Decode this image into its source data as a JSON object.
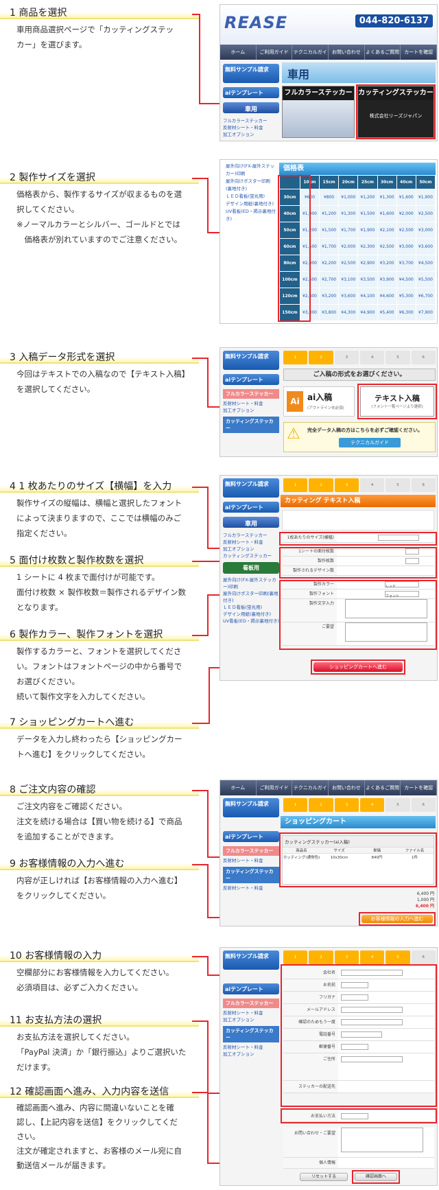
{
  "steps": [
    {
      "title": "1 商品を選択",
      "body": [
        "車用商品選択ページで「カッティングステッ",
        "カー」を選びます。"
      ]
    },
    {
      "title": "2 製作サイズを選択",
      "body": [
        "価格表から、製作するサイズが収まるものを選",
        "択してください。"
      ],
      "note": [
        "※ノーマルカラーとシルバー、ゴールドとでは",
        "　価格表が別れていますのでご注意ください。"
      ]
    },
    {
      "title": "3 入稿データ形式を選択",
      "body": [
        "今回はテキストでの入稿なので【テキスト入稿】",
        "を選択してください。"
      ]
    },
    {
      "title": "4 1 枚あたりのサイズ【横幅】を入力",
      "body": [
        "製作サイズの縦幅は、横幅と選択したフォント",
        "によって決まりますので、ここでは横幅のみご",
        "指定ください。"
      ]
    },
    {
      "title": "5 面付け枚数と製作枚数を選択",
      "body": [
        "1 シートに 4 枚まで面付けが可能です。",
        "面付け枚数 × 製作枚数＝製作されるデザイン数",
        "となります。"
      ]
    },
    {
      "title": "6 製作カラー、製作フォントを選択",
      "body": [
        "製作するカラーと、フォントを選択してくださ",
        "い。フォントはフォントページの中から番号で",
        "お選びください。",
        "続いて製作文字を入力してください。"
      ]
    },
    {
      "title": "7 ショッピングカートへ進む",
      "body": [
        "データを入力し終わったら【ショッピングカー",
        "トへ進む】をクリックしてください。"
      ]
    },
    {
      "title": "8 ご注文内容の確認",
      "body": [
        "ご注文内容をご確認ください。",
        "注文を続ける場合は【買い物を続ける】で商品",
        "を追加することができます。"
      ]
    },
    {
      "title": "9 お客様情報の入力へ進む",
      "body": [
        "内容が正しければ【お客様情報の入力へ進む】",
        "をクリックしてください。"
      ]
    },
    {
      "title": "10 お客様情報の入力",
      "body": [
        "空欄部分にお客様情報を入力してください。",
        "必須項目は、必ずご入力ください。"
      ]
    },
    {
      "title": "11 お支払方法の選択",
      "body": [
        "お支払方法を選択してください。",
        "「PayPal 決済」か「銀行振込」よりご選択いた",
        "だけます。"
      ]
    },
    {
      "title": "12 確認画面へ進み、入力内容を送信",
      "body": [
        "確認画面へ進み、内容に間違いないことを確",
        "認し、【上記内容を送信】をクリックしてくだ",
        "さい。",
        "注文が確定されますと、お客様のメール宛に自",
        "動送信メールが届きます。"
      ]
    }
  ],
  "shot1": {
    "logo": "REASE",
    "tel": "044-820-6137",
    "nav": [
      "ホーム",
      "ご利用ガイド",
      "テクニカルガイド",
      "お問い合わせ",
      "よくあるご質問",
      "カートを確認"
    ],
    "sample_btn": "無料サンプル請求",
    "ai_btn": "aiテンプレート",
    "car_btn": "車用",
    "banner": "車用",
    "card_full": "フルカラーステッカー",
    "card_cut": "カッティングステッカー",
    "card_cut_sub": "株式会社リーズジャパン",
    "links": [
      "フルカラーステッカー",
      "反射材シート・料金",
      "加工オプション"
    ]
  },
  "shot2": {
    "title": "価格表",
    "cols": [
      "10cm",
      "15cm",
      "20cm",
      "25cm",
      "30cm",
      "40cm",
      "50cm"
    ],
    "rows": [
      {
        "h": "30cm",
        "v": [
          "¥600",
          "¥800",
          "¥1,000",
          "¥1,200",
          "¥1,300",
          "¥1,600",
          "¥1,900"
        ]
      },
      {
        "h": "40cm",
        "v": [
          "¥1,000",
          "¥1,200",
          "¥1,300",
          "¥1,500",
          "¥1,600",
          "¥2,000",
          "¥2,500"
        ]
      },
      {
        "h": "50cm",
        "v": [
          "¥1,200",
          "¥1,500",
          "¥1,700",
          "¥1,900",
          "¥2,100",
          "¥2,500",
          "¥3,000"
        ]
      },
      {
        "h": "60cm",
        "v": [
          "¥1,500",
          "¥1,700",
          "¥2,000",
          "¥2,300",
          "¥2,500",
          "¥3,000",
          "¥3,600"
        ]
      },
      {
        "h": "80cm",
        "v": [
          "¥2,000",
          "¥2,200",
          "¥2,500",
          "¥2,900",
          "¥3,200",
          "¥3,700",
          "¥4,500"
        ]
      },
      {
        "h": "100cm",
        "v": [
          "¥2,500",
          "¥2,700",
          "¥3,100",
          "¥3,500",
          "¥3,900",
          "¥4,500",
          "¥5,500"
        ]
      },
      {
        "h": "120cm",
        "v": [
          "¥2,800",
          "¥3,200",
          "¥3,600",
          "¥4,100",
          "¥4,600",
          "¥5,300",
          "¥6,700"
        ]
      },
      {
        "h": "150cm",
        "v": [
          "¥3,300",
          "¥3,800",
          "¥4,300",
          "¥4,900",
          "¥5,400",
          "¥6,300",
          "¥7,900"
        ]
      }
    ],
    "links": [
      "屋外向け(FX-屋外ステッカー)印刷",
      "屋外向けポスター印刷(裏地付き)",
      "ＬＥＤ看板(蛍光用)",
      "デザイン用紙(裏地付き)",
      "UV看板(ED・掲示裏地付き)"
    ]
  },
  "shot3": {
    "heading": "ご入稿の形式をお選びください。",
    "ai_label": "ai入稿",
    "ai_sub": "(アウトライン化必須)",
    "text_label": "テキスト入稿",
    "text_sub": "(フォント一覧ページより選択)",
    "warn": "完全データ入稿の方はこちらを必ずご確認ください。",
    "guide": "テクニカルガイド",
    "full_sec": "フルカラーステッカー",
    "cut_sec": "カッティングステッカー"
  },
  "shot4": {
    "title": "カッティング テキスト入稿",
    "fields": [
      "1枚あたりのサイズ(横幅)",
      "1シートの面付枚数",
      "製作枚数",
      "製作されるデザイン数",
      "製作カラー",
      "製作フォント",
      "製作文字入力",
      "ご要望"
    ],
    "color_val": "レッド",
    "font_val": "フォント",
    "submit": "ショッピングカートへ進む",
    "side_secs": [
      "車用",
      "看板用"
    ]
  },
  "shot5": {
    "title": "ショッピングカート",
    "item": "カッティングステッカー(ai入稿)",
    "cols": [
      "商品名",
      "サイズ",
      "単価",
      "ファイル名"
    ],
    "row": [
      "カッティング(通常色)",
      "10x30cm",
      "840円",
      "1件"
    ],
    "subtotal": "6,400 円",
    "shipping": "1,000 円",
    "total": "6,400 円",
    "next_btn": "お客様情報の入力へ進む"
  },
  "shot6": {
    "fields": [
      "会社名",
      "お名前",
      "フリガナ",
      "メールアドレス",
      "確認のためもう一度",
      "電話番号",
      "郵便番号",
      "ご住所",
      "ステッカーの配送先",
      "お支払い方法",
      "お問い合わせ・ご要望",
      "個人情報"
    ],
    "reset": "リセットする",
    "confirm": "確認画面へ"
  }
}
